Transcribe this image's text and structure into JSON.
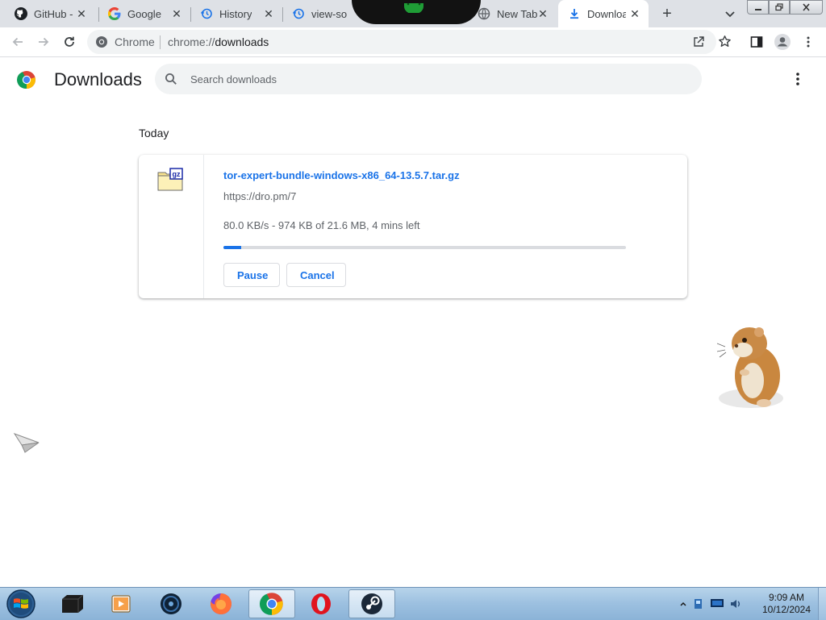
{
  "tabs": [
    {
      "title": "GitHub -",
      "icon": "github-icon"
    },
    {
      "title": "Google",
      "icon": "google-icon"
    },
    {
      "title": "History",
      "icon": "history-icon"
    },
    {
      "title": "view-so",
      "icon": "history-icon"
    },
    {
      "title": "New Tab",
      "icon": "globe-icon"
    },
    {
      "title": "Downloa",
      "icon": "download-icon",
      "active": true
    }
  ],
  "tab_close_glyph": "✕",
  "new_tab_glyph": "+",
  "toolbar": {
    "site_label": "Chrome",
    "url_scheme": "chrome://",
    "url_host": "downloads"
  },
  "page": {
    "title": "Downloads",
    "search_placeholder": "Search downloads",
    "section_label": "Today"
  },
  "download": {
    "file_name": "tor-expert-bundle-windows-x86_64-13.5.7.tar.gz",
    "source_url": "https://dro.pm/7",
    "status": "80.0 KB/s - 974 KB of 21.6 MB, 4 mins left",
    "progress_fraction": 0.045,
    "file_icon_label": "gz",
    "pause_label": "Pause",
    "cancel_label": "Cancel"
  },
  "taskbar": {
    "time": "9:09 AM",
    "date": "10/12/2024",
    "apps": [
      "terminal-icon",
      "media-player-icon",
      "steam-like-icon",
      "firefox-icon",
      "chrome-icon",
      "opera-icon",
      "steam-icon"
    ]
  },
  "colors": {
    "accent": "#1a73e8",
    "tabstrip": "#dee1e6",
    "taskbar": "#9cc0e0"
  }
}
